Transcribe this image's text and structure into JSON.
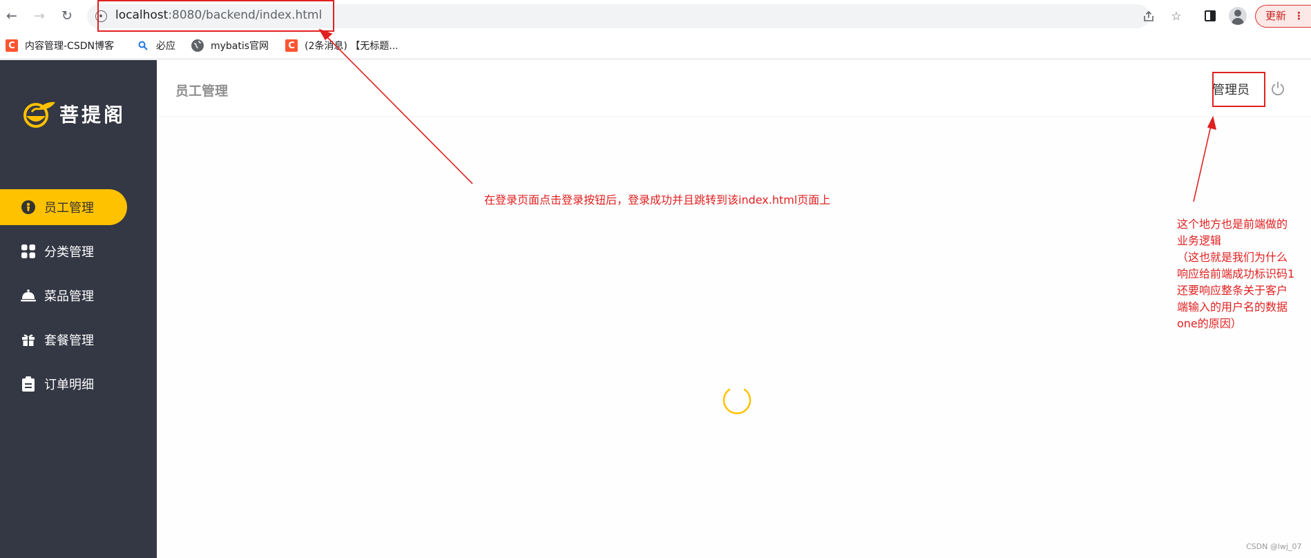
{
  "browser": {
    "url_host": "localhost",
    "url_path": ":8080/backend/index.html",
    "update_label": "更新",
    "bookmarks": [
      {
        "label": "内容管理-CSDN博客",
        "icon": "C"
      },
      {
        "label": "必应",
        "icon": "bing-icon"
      },
      {
        "label": "mybatis官网",
        "icon": "globe-icon"
      },
      {
        "label": "(2条消息) 【无标题...",
        "icon": "C"
      }
    ]
  },
  "app": {
    "logo_text": "菩提阁",
    "accent_color": "#ffc200",
    "sidebar_color": "#343744",
    "menu": [
      {
        "label": "员工管理",
        "icon": "employee-icon",
        "active": true
      },
      {
        "label": "分类管理",
        "icon": "category-icon",
        "active": false
      },
      {
        "label": "菜品管理",
        "icon": "dish-icon",
        "active": false
      },
      {
        "label": "套餐管理",
        "icon": "gift-icon",
        "active": false
      },
      {
        "label": "订单明细",
        "icon": "clipboard-icon",
        "active": false
      }
    ],
    "page_title": "员工管理",
    "user_name": "管理员"
  },
  "annotations": {
    "login_note": "在登录页面点击登录按钮后，登录成功并且跳转到该index.html页面上",
    "user_note_lines": [
      "这个地方也是前端做的",
      "业务逻辑",
      "（这也就是我们为什么",
      "响应给前端成功标识码1",
      "还要响应整条关于客户",
      "端输入的用户名的数据",
      "one的原因）"
    ]
  },
  "watermark": "CSDN @lwj_07"
}
